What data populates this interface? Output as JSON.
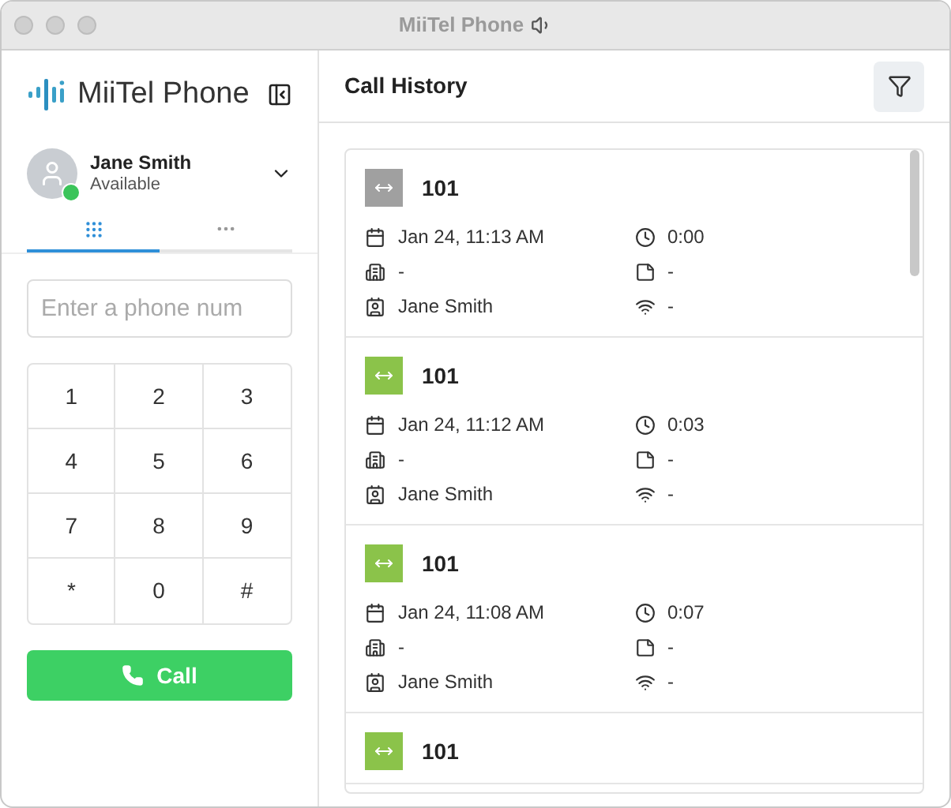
{
  "window": {
    "title": "MiiTel Phone"
  },
  "sidebar": {
    "logo": "MiiTel Phone",
    "user": {
      "name": "Jane Smith",
      "status": "Available",
      "online": true
    },
    "tabs": [
      {
        "kind": "keypad",
        "selected": true
      },
      {
        "kind": "more",
        "selected": false
      }
    ],
    "phone_field": {
      "placeholder": "Enter a phone num"
    },
    "keypad": [
      "1",
      "2",
      "3",
      "4",
      "5",
      "6",
      "7",
      "8",
      "9",
      "*",
      "0",
      "#"
    ],
    "call_button": "Call"
  },
  "main": {
    "title": "Call History",
    "calls": [
      {
        "number": "101",
        "color": "#a0a0a0",
        "date": "Jan 24, 11:13 AM",
        "duration": "0:00",
        "company": "-",
        "memo": "-",
        "user": "Jane Smith",
        "signal": "-"
      },
      {
        "number": "101",
        "color": "#8bc34a",
        "date": "Jan 24, 11:12 AM",
        "duration": "0:03",
        "company": "-",
        "memo": "-",
        "user": "Jane Smith",
        "signal": "-"
      },
      {
        "number": "101",
        "color": "#8bc34a",
        "date": "Jan 24, 11:08 AM",
        "duration": "0:07",
        "company": "-",
        "memo": "-",
        "user": "Jane Smith",
        "signal": "-"
      },
      {
        "number": "101",
        "color": "#8bc34a"
      }
    ]
  }
}
